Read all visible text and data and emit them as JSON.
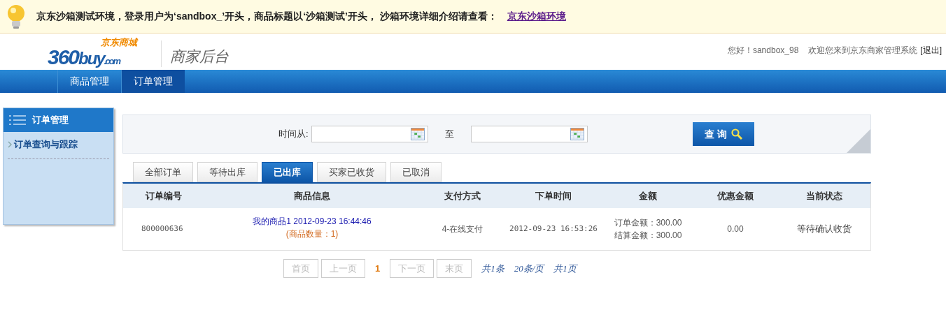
{
  "notice": {
    "text": "京东沙箱测试环境，登录用户为‘sandbox_’开头，商品标题以‘沙箱测试’开头， 沙箱环境详细介绍请查看：",
    "link": "京东沙箱环境"
  },
  "header": {
    "logo_number": "360",
    "logo_buy": "buy",
    "logo_com": ".com",
    "logo_cn": "京东商城",
    "subtitle": "商家后台",
    "greeting": "您好！sandbox_98",
    "welcome": "欢迎您来到京东商家管理系统",
    "logout": "[退出]"
  },
  "nav": [
    {
      "label": "商品管理",
      "selected": false
    },
    {
      "label": "订单管理",
      "selected": true
    }
  ],
  "sidebar": {
    "title": "订单管理",
    "items": [
      {
        "label": "订单查询与跟踪",
        "selected": true
      }
    ]
  },
  "search": {
    "from_label": "时间从:",
    "to_label": "至",
    "button": "查 询"
  },
  "tabs": [
    {
      "label": "全部订单",
      "selected": false
    },
    {
      "label": "等待出库",
      "selected": false
    },
    {
      "label": "已出库",
      "selected": true
    },
    {
      "label": "买家已收货",
      "selected": false
    },
    {
      "label": "已取消",
      "selected": false
    }
  ],
  "table": {
    "columns": [
      "订单编号",
      "商品信息",
      "支付方式",
      "下单时间",
      "金额",
      "优惠金额",
      "当前状态"
    ],
    "rows": [
      {
        "order_no": "800000636",
        "product": "我的商品1 2012-09-23 16:44:46",
        "quantity": "(商品数量：1)",
        "payment": "4-在线支付",
        "time": "2012-09-23 16:53:26",
        "amount_lines": [
          "订单金额：300.00",
          "结算金额：300.00"
        ],
        "discount": "0.00",
        "status": "等待确认收货"
      }
    ]
  },
  "pagination": {
    "pages": [
      {
        "label": "首页",
        "kind": "button",
        "disabled": true
      },
      {
        "label": "上一页",
        "kind": "button",
        "disabled": true
      },
      {
        "label": "1",
        "kind": "current"
      },
      {
        "label": "下一页",
        "kind": "button",
        "disabled": true
      },
      {
        "label": "末页",
        "kind": "button",
        "disabled": true
      }
    ],
    "info": [
      "共1条",
      "20条/页",
      "共1页"
    ]
  }
}
